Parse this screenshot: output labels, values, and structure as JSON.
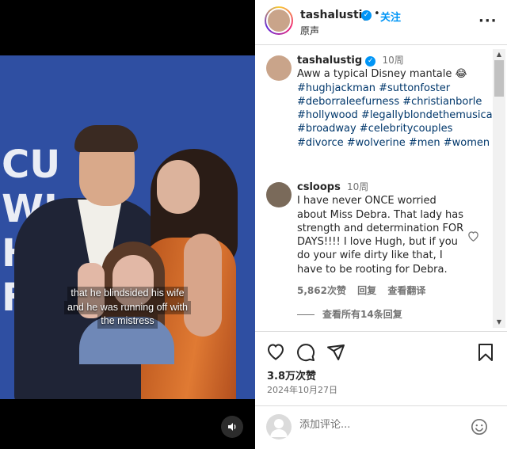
{
  "media": {
    "background_text": [
      "CU",
      "WI",
      "HI",
      "F"
    ],
    "subtitle_lines": [
      "that he blindsided his wife",
      "and he was running off with",
      "the mistress"
    ],
    "sound_icon": "speaker-icon"
  },
  "header": {
    "username": "tashalustig",
    "dot": "•",
    "follow_label": "关注",
    "subtitle": "原声",
    "more_label": "···"
  },
  "caption": {
    "username": "tashalustig",
    "time": "10周",
    "text": "Aww a typical Disney mantale 😂",
    "hashtags": "#hughjackman #suttonfoster #deborraleefurness #christianborle #hollywood #legallyblondethemusical #broadway #celebritycouples #divorce #wolverine #men #women"
  },
  "comment": {
    "username": "csloops",
    "time": "10周",
    "text": "I have never ONCE worried about Miss Debra. That lady has strength and determination FOR DAYS!!!! I love Hugh, but if you do your wife dirty like that, I have to be rooting for Debra.",
    "likes": "5,862次赞",
    "reply_label": "回复",
    "translate_label": "查看翻译",
    "view_replies": "查看所有14条回复"
  },
  "actions": {
    "like_count": "3.8万次赞",
    "date": "2024年10月27日"
  },
  "comment_input": {
    "placeholder": "添加评论..."
  },
  "colors": {
    "link_blue": "#0095f6",
    "hashtag_blue": "#00376b",
    "muted": "#737373",
    "text": "#262626",
    "photo_background": "#2f4fa2",
    "dress_orange": "#e07a33"
  }
}
